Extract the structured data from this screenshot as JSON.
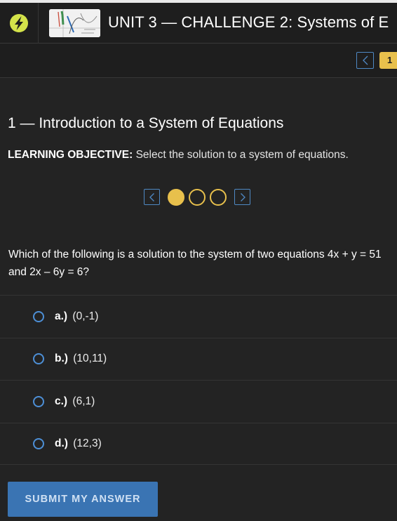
{
  "header": {
    "unit_title": "UNIT 3 — CHALLENGE 2: Systems of E",
    "logo_icon": "sophia-logo-icon",
    "thumbnail_icon": "graph-thumbnail-icon"
  },
  "nav": {
    "prev_icon": "chevron-left-icon",
    "current_page": "1"
  },
  "lesson": {
    "title": "1 — Introduction to a System of Equations",
    "objective_label": "LEARNING OBJECTIVE:",
    "objective_text": " Select the solution to a system of equations."
  },
  "carousel": {
    "prev_icon": "chevron-left-icon",
    "next_icon": "chevron-right-icon",
    "dots": [
      "active",
      "inactive",
      "inactive"
    ]
  },
  "question": {
    "text": "Which of the following is a solution to the system of two equations 4x + y = 51 and 2x – 6y = 6?"
  },
  "options": [
    {
      "letter": "a.)",
      "value": "(0,-1)"
    },
    {
      "letter": "b.)",
      "value": "(10,11)"
    },
    {
      "letter": "c.)",
      "value": "(6,1)"
    },
    {
      "letter": "d.)",
      "value": "(12,3)"
    }
  ],
  "submit": {
    "label": "SUBMIT MY ANSWER"
  },
  "colors": {
    "accent_yellow": "#e8c04c",
    "accent_blue": "#4f89c4",
    "button_blue": "#3a74b3",
    "background": "#232323"
  }
}
